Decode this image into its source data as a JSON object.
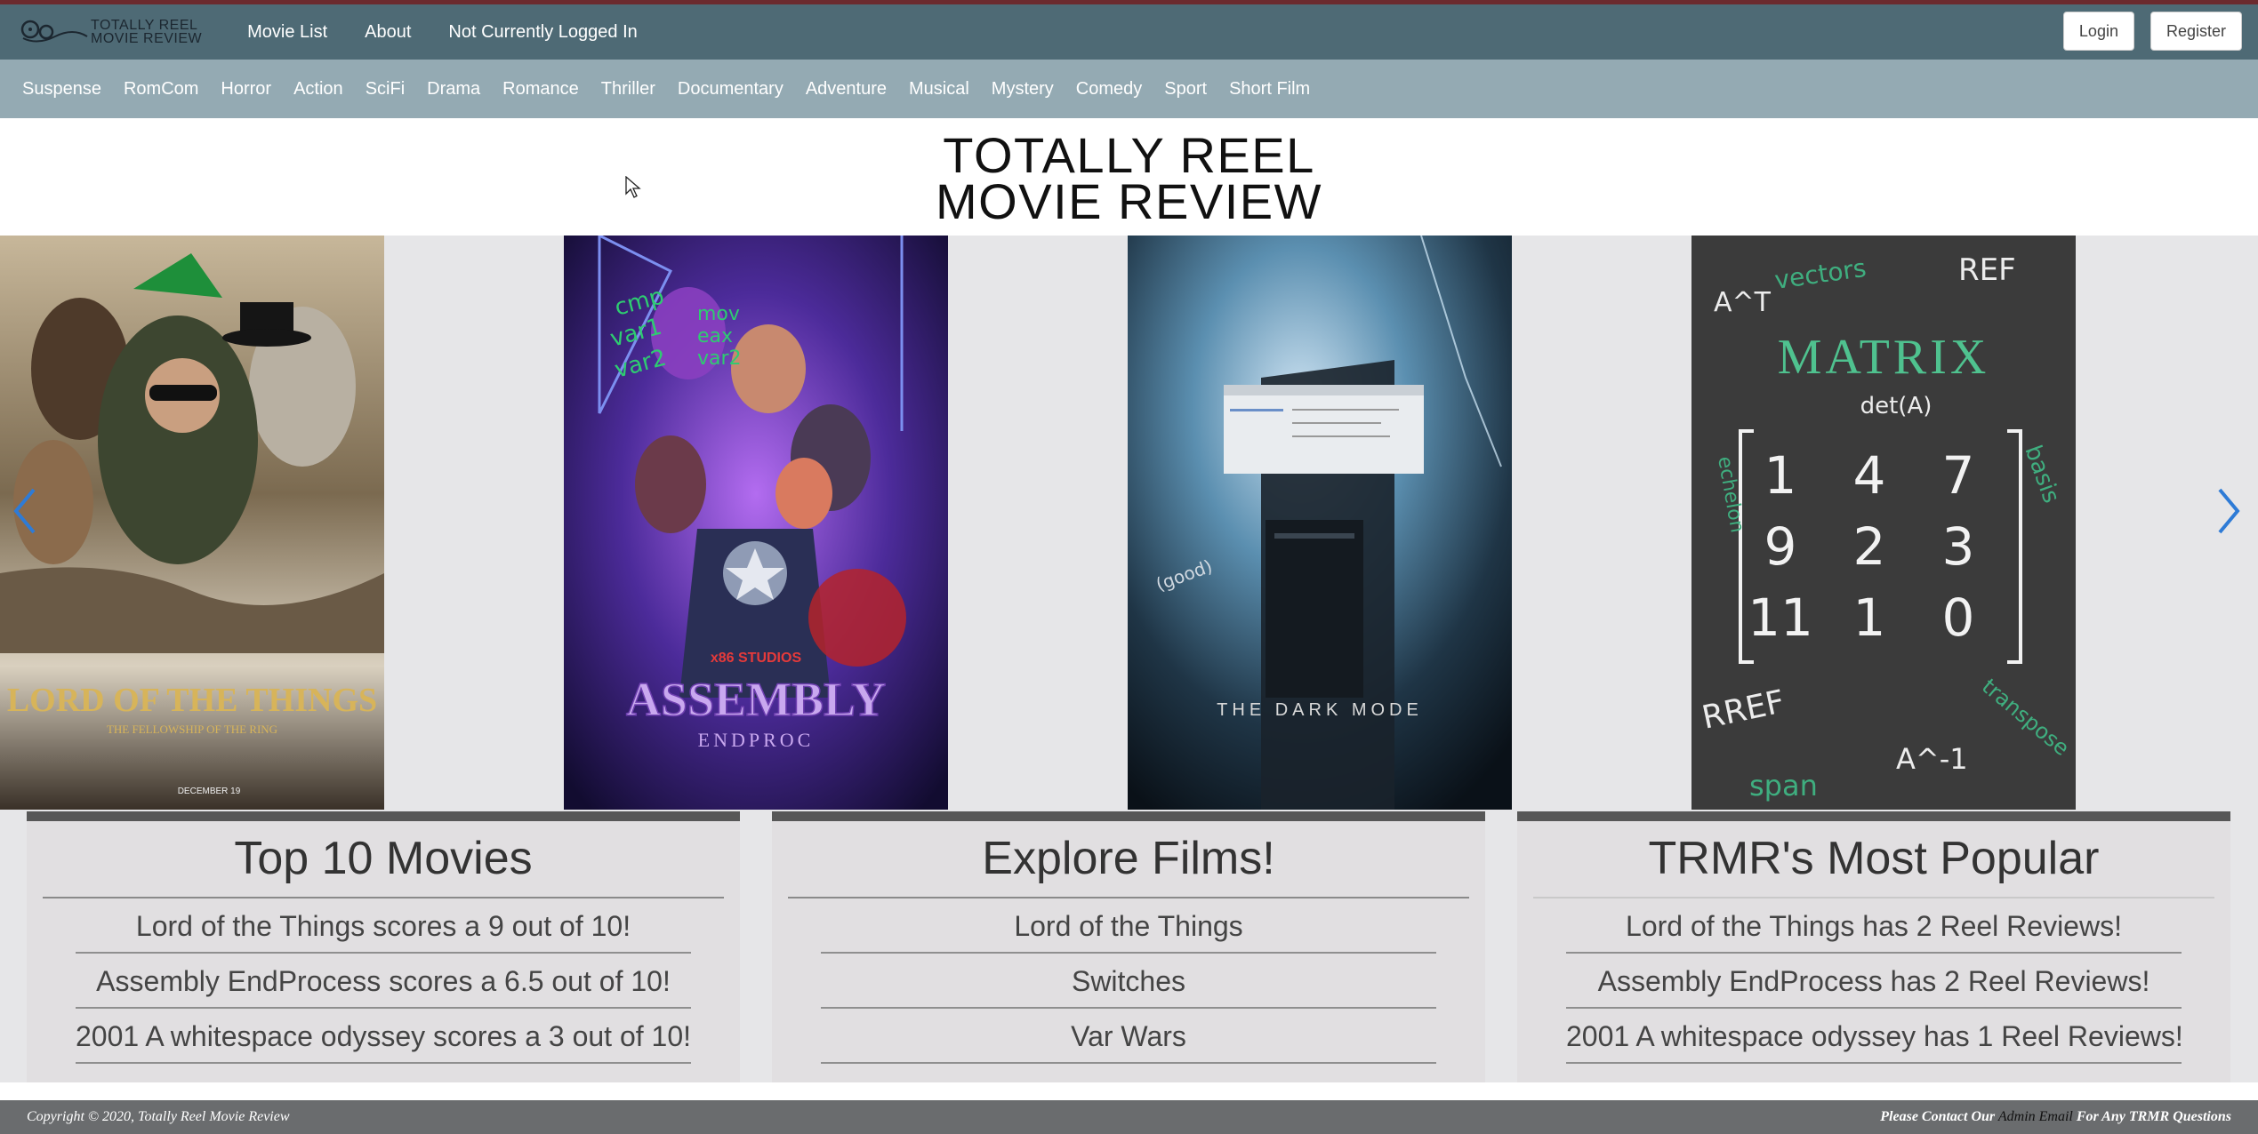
{
  "brand": {
    "line1": "TOTALLY REEL",
    "line2": "MOVIE REVIEW"
  },
  "nav": {
    "links": [
      "Movie List",
      "About",
      "Not Currently Logged In"
    ],
    "login": "Login",
    "register": "Register"
  },
  "genres": [
    "Suspense",
    "RomCom",
    "Horror",
    "Action",
    "SciFi",
    "Drama",
    "Romance",
    "Thriller",
    "Documentary",
    "Adventure",
    "Musical",
    "Mystery",
    "Comedy",
    "Sport",
    "Short Film"
  ],
  "site_title": {
    "line1": "TOTALLY REEL",
    "line2": "MOVIE REVIEW"
  },
  "carousel": {
    "posters": [
      {
        "title": "LORD OF THE THINGS",
        "subtitle": "THE FELLOWSHIP OF THE RING",
        "date": "DECEMBER 19"
      },
      {
        "title": "ASSEMBLY",
        "subtitle": "ENDPROC",
        "badge": "x86 STUDIOS",
        "notes": [
          "cmp",
          "var1",
          "var2",
          "mov",
          "eax",
          "var2"
        ]
      },
      {
        "title": "THE DARK MODE",
        "notes": [
          "(good)"
        ]
      },
      {
        "title": "MATRIX",
        "notes": [
          "A^T",
          "vectors",
          "REF",
          "det(A)",
          "echelon",
          "basis",
          "RREF",
          "transpose",
          "A^-1",
          "span"
        ],
        "matrix": [
          "1",
          "4",
          "7",
          "9",
          "2",
          "3",
          "11",
          "1",
          "0"
        ]
      }
    ],
    "prev_icon": "chevron-left-icon",
    "next_icon": "chevron-right-icon"
  },
  "panels": [
    {
      "title": "Top 10 Movies",
      "items": [
        "Lord of the Things scores a 9 out of 10!",
        "Assembly EndProcess scores a 6.5 out of 10!",
        "2001 A whitespace odyssey scores a 3 out of 10!"
      ]
    },
    {
      "title": "Explore Films!",
      "items": [
        "Lord of the Things",
        "Switches",
        "Var Wars"
      ]
    },
    {
      "title": "TRMR's Most Popular",
      "items": [
        "Lord of the Things has 2 Reel Reviews!",
        "Assembly EndProcess has 2 Reel Reviews!",
        "2001 A whitespace odyssey has 1 Reel Reviews!"
      ]
    }
  ],
  "footer": {
    "copyright": "Copyright © 2020, Totally Reel Movie Review",
    "contact_prefix": "Please Contact Our",
    "admin_email": "Admin Email",
    "contact_suffix": "For Any TRMR Questions"
  },
  "colors": {
    "navbar": "#4e6a75",
    "genre_bar": "#94aab3",
    "top_line": "#6b2a2e",
    "panel_border": "#575757",
    "footer": "#6a6c6e",
    "arrow": "#2e7bd6"
  }
}
